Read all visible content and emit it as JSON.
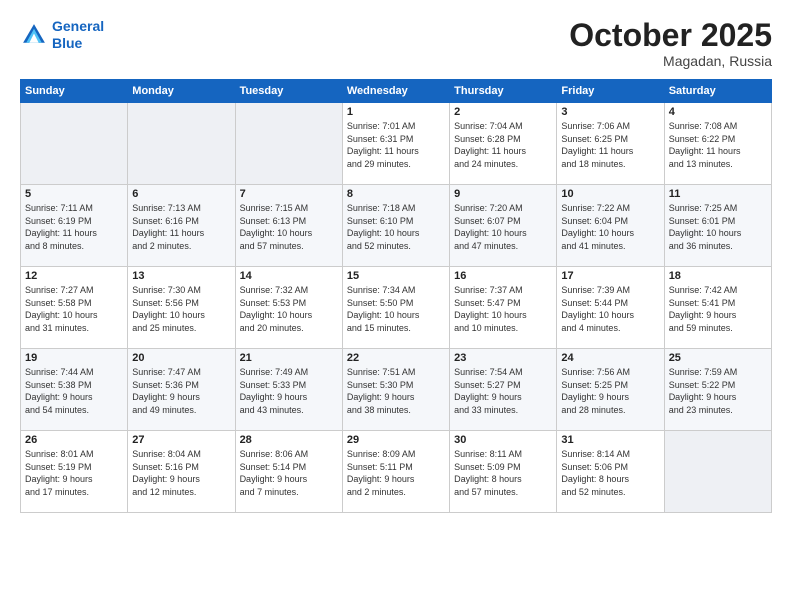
{
  "header": {
    "logo_line1": "General",
    "logo_line2": "Blue",
    "month": "October 2025",
    "location": "Magadan, Russia"
  },
  "days_of_week": [
    "Sunday",
    "Monday",
    "Tuesday",
    "Wednesday",
    "Thursday",
    "Friday",
    "Saturday"
  ],
  "weeks": [
    [
      {
        "day": "",
        "content": ""
      },
      {
        "day": "",
        "content": ""
      },
      {
        "day": "",
        "content": ""
      },
      {
        "day": "1",
        "content": "Sunrise: 7:01 AM\nSunset: 6:31 PM\nDaylight: 11 hours\nand 29 minutes."
      },
      {
        "day": "2",
        "content": "Sunrise: 7:04 AM\nSunset: 6:28 PM\nDaylight: 11 hours\nand 24 minutes."
      },
      {
        "day": "3",
        "content": "Sunrise: 7:06 AM\nSunset: 6:25 PM\nDaylight: 11 hours\nand 18 minutes."
      },
      {
        "day": "4",
        "content": "Sunrise: 7:08 AM\nSunset: 6:22 PM\nDaylight: 11 hours\nand 13 minutes."
      }
    ],
    [
      {
        "day": "5",
        "content": "Sunrise: 7:11 AM\nSunset: 6:19 PM\nDaylight: 11 hours\nand 8 minutes."
      },
      {
        "day": "6",
        "content": "Sunrise: 7:13 AM\nSunset: 6:16 PM\nDaylight: 11 hours\nand 2 minutes."
      },
      {
        "day": "7",
        "content": "Sunrise: 7:15 AM\nSunset: 6:13 PM\nDaylight: 10 hours\nand 57 minutes."
      },
      {
        "day": "8",
        "content": "Sunrise: 7:18 AM\nSunset: 6:10 PM\nDaylight: 10 hours\nand 52 minutes."
      },
      {
        "day": "9",
        "content": "Sunrise: 7:20 AM\nSunset: 6:07 PM\nDaylight: 10 hours\nand 47 minutes."
      },
      {
        "day": "10",
        "content": "Sunrise: 7:22 AM\nSunset: 6:04 PM\nDaylight: 10 hours\nand 41 minutes."
      },
      {
        "day": "11",
        "content": "Sunrise: 7:25 AM\nSunset: 6:01 PM\nDaylight: 10 hours\nand 36 minutes."
      }
    ],
    [
      {
        "day": "12",
        "content": "Sunrise: 7:27 AM\nSunset: 5:58 PM\nDaylight: 10 hours\nand 31 minutes."
      },
      {
        "day": "13",
        "content": "Sunrise: 7:30 AM\nSunset: 5:56 PM\nDaylight: 10 hours\nand 25 minutes."
      },
      {
        "day": "14",
        "content": "Sunrise: 7:32 AM\nSunset: 5:53 PM\nDaylight: 10 hours\nand 20 minutes."
      },
      {
        "day": "15",
        "content": "Sunrise: 7:34 AM\nSunset: 5:50 PM\nDaylight: 10 hours\nand 15 minutes."
      },
      {
        "day": "16",
        "content": "Sunrise: 7:37 AM\nSunset: 5:47 PM\nDaylight: 10 hours\nand 10 minutes."
      },
      {
        "day": "17",
        "content": "Sunrise: 7:39 AM\nSunset: 5:44 PM\nDaylight: 10 hours\nand 4 minutes."
      },
      {
        "day": "18",
        "content": "Sunrise: 7:42 AM\nSunset: 5:41 PM\nDaylight: 9 hours\nand 59 minutes."
      }
    ],
    [
      {
        "day": "19",
        "content": "Sunrise: 7:44 AM\nSunset: 5:38 PM\nDaylight: 9 hours\nand 54 minutes."
      },
      {
        "day": "20",
        "content": "Sunrise: 7:47 AM\nSunset: 5:36 PM\nDaylight: 9 hours\nand 49 minutes."
      },
      {
        "day": "21",
        "content": "Sunrise: 7:49 AM\nSunset: 5:33 PM\nDaylight: 9 hours\nand 43 minutes."
      },
      {
        "day": "22",
        "content": "Sunrise: 7:51 AM\nSunset: 5:30 PM\nDaylight: 9 hours\nand 38 minutes."
      },
      {
        "day": "23",
        "content": "Sunrise: 7:54 AM\nSunset: 5:27 PM\nDaylight: 9 hours\nand 33 minutes."
      },
      {
        "day": "24",
        "content": "Sunrise: 7:56 AM\nSunset: 5:25 PM\nDaylight: 9 hours\nand 28 minutes."
      },
      {
        "day": "25",
        "content": "Sunrise: 7:59 AM\nSunset: 5:22 PM\nDaylight: 9 hours\nand 23 minutes."
      }
    ],
    [
      {
        "day": "26",
        "content": "Sunrise: 8:01 AM\nSunset: 5:19 PM\nDaylight: 9 hours\nand 17 minutes."
      },
      {
        "day": "27",
        "content": "Sunrise: 8:04 AM\nSunset: 5:16 PM\nDaylight: 9 hours\nand 12 minutes."
      },
      {
        "day": "28",
        "content": "Sunrise: 8:06 AM\nSunset: 5:14 PM\nDaylight: 9 hours\nand 7 minutes."
      },
      {
        "day": "29",
        "content": "Sunrise: 8:09 AM\nSunset: 5:11 PM\nDaylight: 9 hours\nand 2 minutes."
      },
      {
        "day": "30",
        "content": "Sunrise: 8:11 AM\nSunset: 5:09 PM\nDaylight: 8 hours\nand 57 minutes."
      },
      {
        "day": "31",
        "content": "Sunrise: 8:14 AM\nSunset: 5:06 PM\nDaylight: 8 hours\nand 52 minutes."
      },
      {
        "day": "",
        "content": ""
      }
    ]
  ]
}
